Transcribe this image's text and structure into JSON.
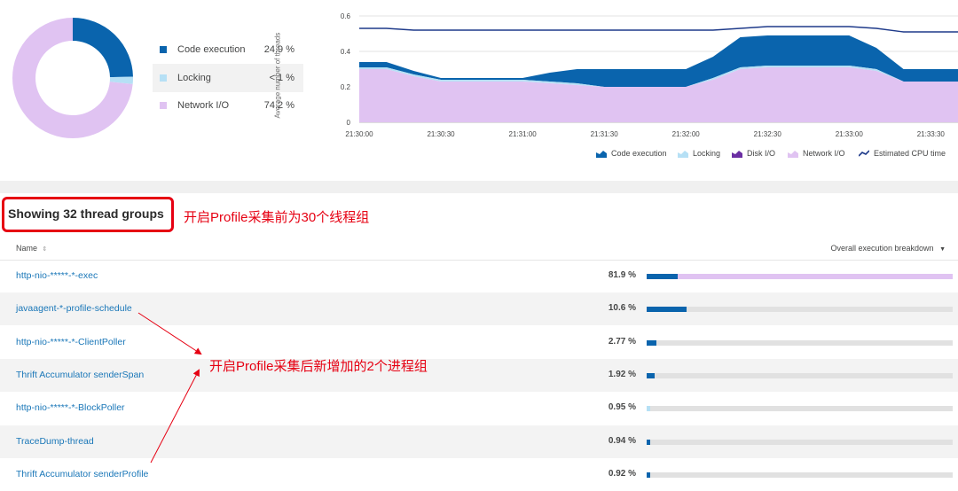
{
  "donut": {
    "legend": [
      {
        "label": "Code execution",
        "value": "24.9 %",
        "color": "#0a64ad",
        "fraction": 0.249
      },
      {
        "label": "Locking",
        "value": "< 1 %",
        "color": "#b6e0f5",
        "fraction": 0.02
      },
      {
        "label": "Network I/O",
        "value": "74.2 %",
        "color": "#e0c3f2",
        "fraction": 0.742
      }
    ]
  },
  "chart_data": {
    "type": "area",
    "ylabel": "Average number of threads",
    "ylim": [
      0,
      0.6
    ],
    "yticks": [
      "0",
      "0.2",
      "0.4",
      "0.6"
    ],
    "xticks": [
      "21:30:00",
      "21:30:30",
      "21:31:00",
      "21:31:30",
      "21:32:00",
      "21:32:30",
      "21:33:00",
      "21:33:30"
    ],
    "x": [
      "21:30:00",
      "21:30:10",
      "21:30:20",
      "21:30:30",
      "21:30:40",
      "21:30:50",
      "21:31:00",
      "21:31:10",
      "21:31:20",
      "21:31:30",
      "21:31:40",
      "21:31:50",
      "21:32:00",
      "21:32:10",
      "21:32:20",
      "21:32:30",
      "21:32:40",
      "21:32:50",
      "21:33:00",
      "21:33:10",
      "21:33:20",
      "21:33:30",
      "21:33:40"
    ],
    "series": [
      {
        "name": "Network I/O",
        "color": "#e0c3f2",
        "values": [
          0.3,
          0.3,
          0.26,
          0.23,
          0.23,
          0.23,
          0.23,
          0.22,
          0.21,
          0.2,
          0.2,
          0.2,
          0.2,
          0.24,
          0.3,
          0.31,
          0.31,
          0.31,
          0.31,
          0.29,
          0.23,
          0.23,
          0.23
        ]
      },
      {
        "name": "Locking",
        "color": "#b6e0f5",
        "values": [
          0.01,
          0.01,
          0.01,
          0.01,
          0.01,
          0.01,
          0.01,
          0.01,
          0.01,
          0.0,
          0.0,
          0.0,
          0.0,
          0.01,
          0.01,
          0.01,
          0.01,
          0.01,
          0.01,
          0.01,
          0.0,
          0.0,
          0.0
        ]
      },
      {
        "name": "Code execution",
        "color": "#0a64ad",
        "values": [
          0.03,
          0.03,
          0.02,
          0.01,
          0.01,
          0.01,
          0.01,
          0.05,
          0.08,
          0.1,
          0.1,
          0.1,
          0.1,
          0.12,
          0.17,
          0.17,
          0.17,
          0.17,
          0.17,
          0.12,
          0.07,
          0.07,
          0.07
        ]
      },
      {
        "name": "Estimated CPU time",
        "color": "#1e3a8a",
        "values": [
          0.53,
          0.53,
          0.52,
          0.52,
          0.52,
          0.52,
          0.52,
          0.52,
          0.52,
          0.52,
          0.52,
          0.52,
          0.52,
          0.52,
          0.53,
          0.54,
          0.54,
          0.54,
          0.54,
          0.53,
          0.51,
          0.51,
          0.51
        ]
      }
    ],
    "legend": [
      {
        "label": "Code execution",
        "icon": "area-dark-blue"
      },
      {
        "label": "Locking",
        "icon": "area-light-blue"
      },
      {
        "label": "Disk I/O",
        "icon": "area-purple"
      },
      {
        "label": "Network I/O",
        "icon": "area-lavender"
      },
      {
        "label": "Estimated CPU time",
        "icon": "line"
      }
    ]
  },
  "heading": "Showing 32 thread groups",
  "notes": {
    "before": "开启Profile采集前为30个线程组",
    "after": "开启Profile采集后新增加的2个进程组"
  },
  "table": {
    "col_name": "Name",
    "col_sort_icon": "sort-icon",
    "col_breakdown": "Overall execution breakdown",
    "rows": [
      {
        "name": "http-nio-*****-*-exec",
        "pct": "81.9 %",
        "code": 0.1,
        "other": 0.9,
        "other_color": "#e0c3f2"
      },
      {
        "name": "javaagent-*-profile-schedule",
        "pct": "10.6 %",
        "code": 0.13,
        "other": 0,
        "other_color": "#e0c3f2"
      },
      {
        "name": "http-nio-*****-*-ClientPoller",
        "pct": "2.77 %",
        "code": 0.033,
        "other": 0,
        "other_color": "#e0c3f2"
      },
      {
        "name": "Thrift Accumulator senderSpan",
        "pct": "1.92 %",
        "code": 0.025,
        "other": 0,
        "other_color": "#e0c3f2"
      },
      {
        "name": "http-nio-*****-*-BlockPoller",
        "pct": "0.95 %",
        "code": 0,
        "other": 0.012,
        "other_color": "#b6e0f5"
      },
      {
        "name": "TraceDump-thread",
        "pct": "0.94 %",
        "code": 0.011,
        "other": 0,
        "other_color": "#e0c3f2"
      },
      {
        "name": "Thrift Accumulator senderProfile",
        "pct": "0.92 %",
        "code": 0.011,
        "other": 0,
        "other_color": "#e0c3f2"
      }
    ]
  }
}
